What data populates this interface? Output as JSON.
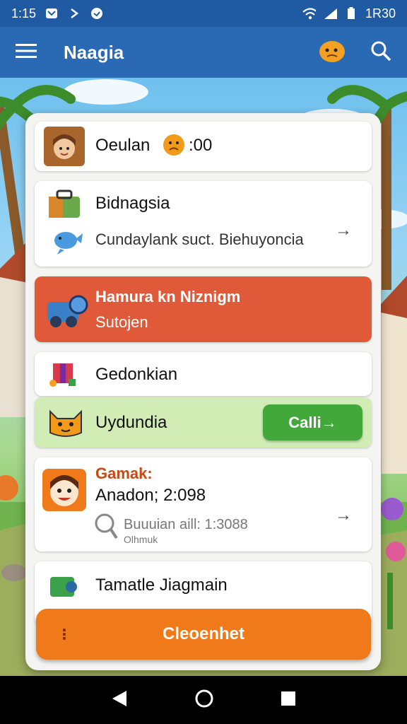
{
  "status_bar": {
    "time": "1:15",
    "battery_text": "1R30"
  },
  "app_bar": {
    "title": "Naagia"
  },
  "rows": [
    {
      "title": "Oeulan",
      "time": ":00"
    },
    {
      "title": "Bidnagsia",
      "subtitle": "Cundaylank suct. Biehuyoncia"
    },
    {
      "title": "Hamura kn Niznigm",
      "subtitle": "Sutojen"
    },
    {
      "title": "Gedonkian"
    },
    {
      "title": "Uydundia",
      "button": "Calli→"
    },
    {
      "label": "Gamak:",
      "title": "Anadon; 2:098",
      "detail": "Buuuian aill: 1:3088",
      "detail2": "Olhmuk"
    },
    {
      "title": "Tamatle Jiagmain"
    }
  ],
  "bottom_button": {
    "label": "Cleoenhet"
  },
  "colors": {
    "status": "#1f5aa3",
    "appbar": "#2a6ab5",
    "red_row": "#e05a3a",
    "green_row": "#d2ecb6",
    "green_button": "#43a83a",
    "orange_button": "#f07a1a"
  }
}
